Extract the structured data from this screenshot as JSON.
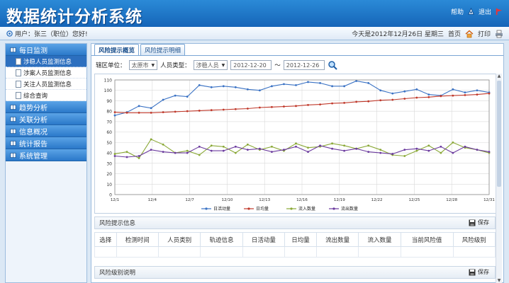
{
  "app": {
    "title": "数据统计分析系统"
  },
  "toplinks": {
    "help": "帮助",
    "logout": "退出"
  },
  "userbar": {
    "user_text": "用户：张三（职位）您好!",
    "date_text": "今天是2012年12月26日 星期三",
    "home": "首页",
    "print": "打印"
  },
  "sidebar": {
    "groups": [
      {
        "label": "每日监测",
        "items": [
          "涉稳人员监测信息",
          "涉案人员监测信息",
          "关注人员监测信息",
          "综合查询"
        ]
      },
      {
        "label": "趋势分析"
      },
      {
        "label": "关联分析"
      },
      {
        "label": "信息概况"
      },
      {
        "label": "统计报告"
      },
      {
        "label": "系统管理"
      }
    ]
  },
  "tabs": [
    "风险提示概览",
    "风险提示明细"
  ],
  "filters": {
    "area_label": "辖区单位：",
    "area_value": "太原市",
    "type_label": "人员类型：",
    "type_value": "涉稳人员",
    "date_from": "2012-12-20",
    "tilde": "～",
    "date_to": "2012-12-26"
  },
  "chart_data": {
    "type": "line",
    "x": [
      "12/1",
      "12/2",
      "12/3",
      "12/4",
      "12/5",
      "12/6",
      "12/7",
      "12/8",
      "12/9",
      "12/10",
      "12/11",
      "12/12",
      "12/13",
      "12/14",
      "12/15",
      "12/16",
      "12/17",
      "12/18",
      "12/19",
      "12/20",
      "12/21",
      "12/22",
      "12/23",
      "12/24",
      "12/25",
      "12/26",
      "12/27",
      "12/28",
      "12/29",
      "12/30",
      "12/31"
    ],
    "xticks": [
      "12/1",
      "12/4",
      "12/7",
      "12/10",
      "12/13",
      "12/16",
      "12/19",
      "12/22",
      "12/25",
      "12/28",
      "12/31"
    ],
    "ylim": [
      0,
      110
    ],
    "yticks": [
      0,
      10,
      20,
      30,
      40,
      50,
      60,
      70,
      80,
      90,
      100,
      110
    ],
    "grid": true,
    "legend": "bottom",
    "series": [
      {
        "name": "日活动量",
        "color": "#3a72c4",
        "values": [
          76,
          79,
          85,
          83,
          91,
          95,
          94,
          105,
          103,
          104,
          103,
          101,
          100,
          104,
          106,
          105,
          108,
          107,
          104,
          104,
          109,
          107,
          100,
          97,
          99,
          101,
          96,
          95,
          101,
          98,
          100,
          98
        ]
      },
      {
        "name": "日均量",
        "color": "#c0392b",
        "values": [
          79,
          78.5,
          78.5,
          78.5,
          79,
          79.5,
          80,
          80.5,
          81,
          81.5,
          82,
          82.5,
          83.5,
          84,
          84.5,
          85,
          86,
          86.5,
          87.5,
          88,
          89,
          89.5,
          90.5,
          91,
          92,
          93,
          93.5,
          94.5,
          95,
          95.5,
          96,
          97
        ]
      },
      {
        "name": "流入数量",
        "color": "#8aa836",
        "values": [
          39,
          41,
          35,
          53,
          48,
          40,
          42,
          38,
          47,
          46,
          40,
          48,
          43,
          46,
          42,
          49,
          45,
          46,
          49,
          47,
          44,
          47,
          43,
          38,
          37,
          42,
          47,
          40,
          50,
          45,
          43,
          40
        ]
      },
      {
        "name": "流出数量",
        "color": "#6b3a9e",
        "values": [
          37,
          36,
          37,
          43,
          41,
          40,
          40,
          46,
          42,
          42,
          46,
          43,
          44,
          41,
          43,
          46,
          41,
          47,
          44,
          42,
          44,
          41,
          40,
          39,
          43,
          44,
          42,
          46,
          40,
          46,
          43,
          41
        ]
      }
    ]
  },
  "risk_panel": {
    "title": "风险提示信息",
    "save": "保存",
    "columns": [
      "选择",
      "检测时间",
      "人员类别",
      "轨迹信息",
      "日活动量",
      "日均量",
      "流出数量",
      "流入数量",
      "当前风险值",
      "风险级别"
    ]
  },
  "level_panel": {
    "title": "风险级别说明",
    "save": "保存"
  }
}
